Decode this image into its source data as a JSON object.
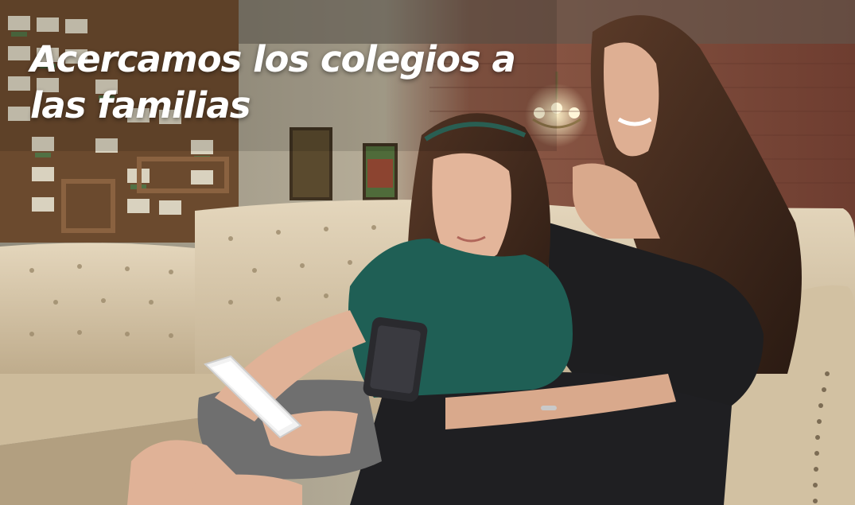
{
  "hero": {
    "headline": "Acercamos los colegios a las familias"
  },
  "colors": {
    "headline_text": "#ffffff",
    "sofa": "#d8c7a8",
    "brick_wall": "#7a4a3a",
    "uniform_green": "#1f5f55",
    "dress_black": "#1e1e20"
  },
  "icons": {
    "chandelier": "chandelier-icon",
    "tablet": "tablet-icon",
    "smartphone": "smartphone-icon"
  }
}
